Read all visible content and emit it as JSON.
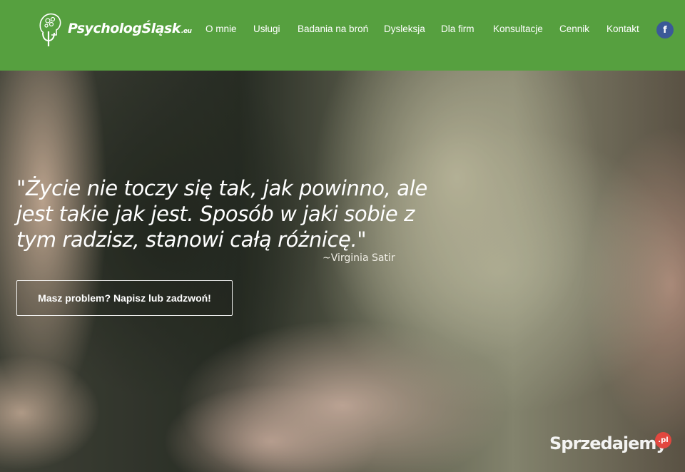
{
  "brand": {
    "name": "PsychologŚląsk",
    "tld": ".eu"
  },
  "nav": {
    "items": [
      {
        "label": "O mnie"
      },
      {
        "label": "Usługi"
      },
      {
        "label": "Badania na broń"
      },
      {
        "label": "Dysleksja"
      },
      {
        "label": "Dla firm"
      },
      {
        "label": "Konsultacje"
      },
      {
        "label": "Cennik"
      },
      {
        "label": "Kontakt"
      }
    ],
    "social_icon": "facebook-icon",
    "social_glyph": "f"
  },
  "hero": {
    "quote": "\"Życie nie toczy się tak, jak powinno, ale jest takie jak jest. Sposób w jaki sobie z tym radzisz, stanowi całą różnicę.\"",
    "author": "~Virginia Satir",
    "cta_label": "Masz problem? Napisz lub zadzwoń!"
  },
  "watermark": {
    "text": "Sprzedajemy",
    "badge": ".pl"
  },
  "colors": {
    "header_bg": "#56a03f",
    "facebook": "#3b5998",
    "watermark_badge": "#e2473f"
  }
}
